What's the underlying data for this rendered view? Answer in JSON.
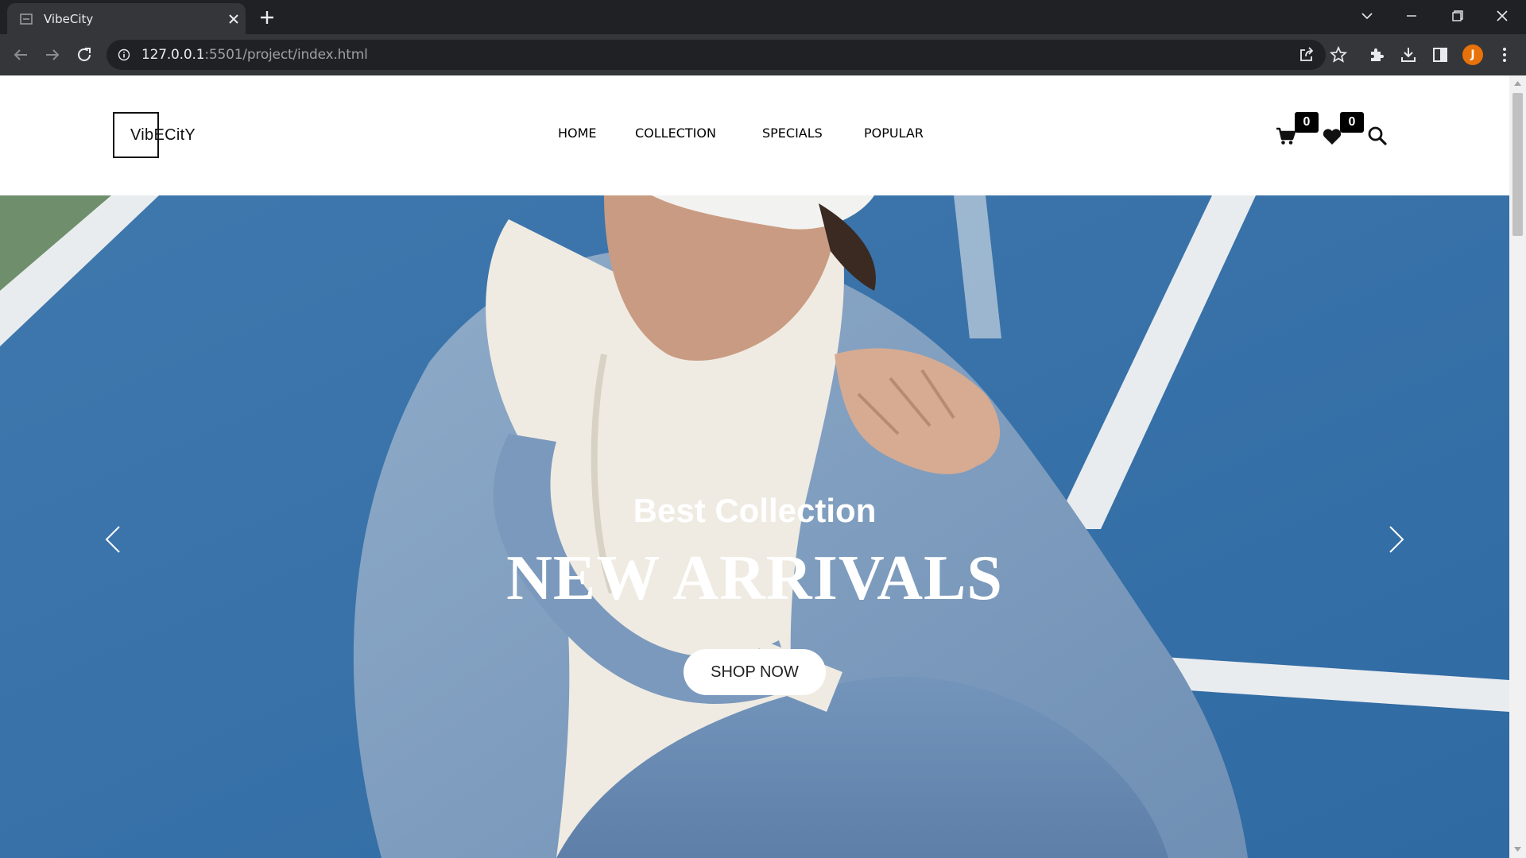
{
  "browser": {
    "tab_title": "VibeCity",
    "url_host": "127.0.0.1",
    "url_rest": ":5501/project/index.html",
    "profile_initial": "J",
    "profile_color": "#e8710a"
  },
  "site": {
    "logo_text": "VibECitY",
    "nav": [
      "HOME",
      "COLLECTION",
      "SPECIALS",
      "POPULAR"
    ],
    "cart_count": "0",
    "wishlist_count": "0"
  },
  "hero": {
    "subtitle": "Best Collection",
    "title": "NEW ARRIVALS",
    "button": "SHOP NOW"
  },
  "icons": {
    "tab": [
      "page-favicon-icon",
      "close-icon",
      "plus-icon"
    ],
    "window": [
      "chevron-down-icon",
      "minimize-icon",
      "restore-icon",
      "close-icon"
    ],
    "toolbar": [
      "back-arrow-icon",
      "forward-arrow-icon",
      "reload-icon",
      "info-icon",
      "share-icon",
      "star-icon",
      "puzzle-icon",
      "download-icon",
      "sidepanel-icon",
      "kebab-menu-icon"
    ],
    "site": [
      "cart-icon",
      "heart-icon",
      "search-icon",
      "chevron-left-icon",
      "chevron-right-icon"
    ]
  }
}
